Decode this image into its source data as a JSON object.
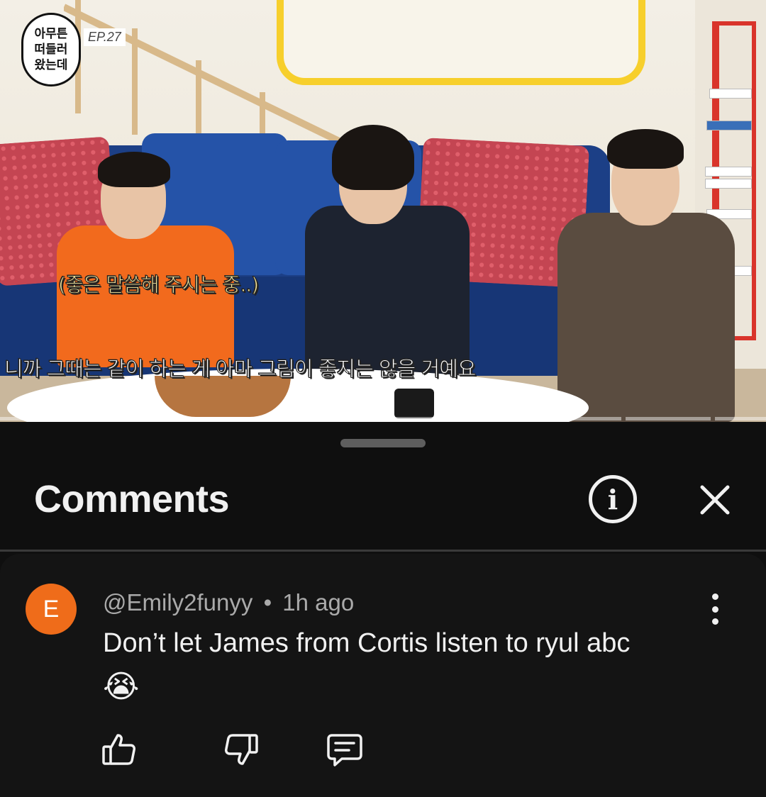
{
  "video": {
    "logo_text": "아무튼\n떠들러\n왔는데",
    "episode": "EP.27",
    "subtitle_small": "(좋은 말씀해 주시는 중..)",
    "subtitle_main": "니까 그때는 같이 하는 게 아마 그림이 좋지는 않을 거예요"
  },
  "sheet": {
    "title": "Comments",
    "info_icon": "info-icon",
    "close_icon": "close-icon"
  },
  "comment": {
    "avatar_letter": "E",
    "avatar_color": "#ef6c1a",
    "author": "@Emily2funyy",
    "separator": "•",
    "time": "1h ago",
    "text": "Don’t let James from Cortis listen to ryul abc",
    "emoji": "😭",
    "actions": [
      "thumbs-up-icon",
      "thumbs-down-icon",
      "reply-icon"
    ]
  }
}
